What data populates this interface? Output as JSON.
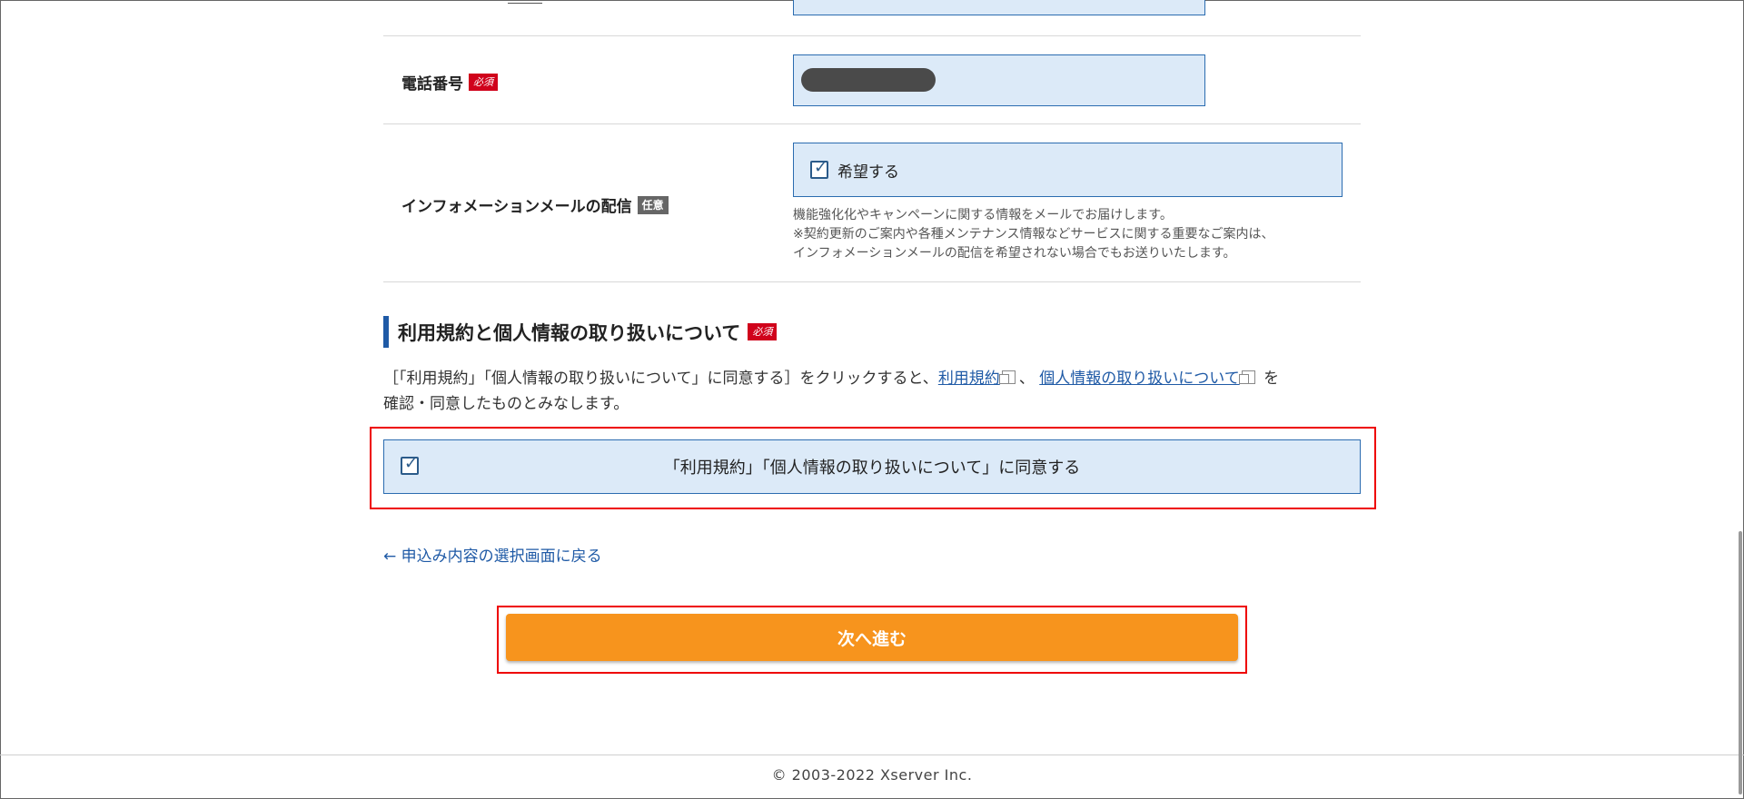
{
  "phone_row": {
    "label": "電話番号",
    "badge": "必須"
  },
  "info_mail_row": {
    "label": "インフォメーションメールの配信",
    "badge": "任意",
    "checkbox_label": "希望する",
    "checked": true,
    "notes": [
      "機能強化化やキャンペーンに関する情報をメールでお届けします。",
      "※契約更新のご案内や各種メンテナンス情報などサービスに関する重要なご案内は、",
      "インフォメーションメールの配信を希望されない場合でもお送りいたします。"
    ]
  },
  "terms_section": {
    "title": "利用規約と個人情報の取り扱いについて",
    "badge": "必須",
    "text_before": "［「利用規約」「個人情報の取り扱いについて」に同意する］をクリックすると、",
    "link_terms": "利用規約",
    "separator": "、",
    "link_privacy": "個人情報の取り扱いについて",
    "text_after": "を",
    "text_line2": "確認・同意したものとみなします。",
    "agree_label": "「利用規約」「個人情報の取り扱いについて」に同意する",
    "agree_checked": true
  },
  "back_link": "← 申込み内容の選択画面に戻る",
  "next_button": "次へ進む",
  "footer": "© 2003-2022 Xserver Inc.",
  "colors": {
    "accent": "#f7941d",
    "required": "#d0021b",
    "input_bg": "#dceaf8",
    "link": "#1f5aa6",
    "highlight": "#e00000"
  }
}
